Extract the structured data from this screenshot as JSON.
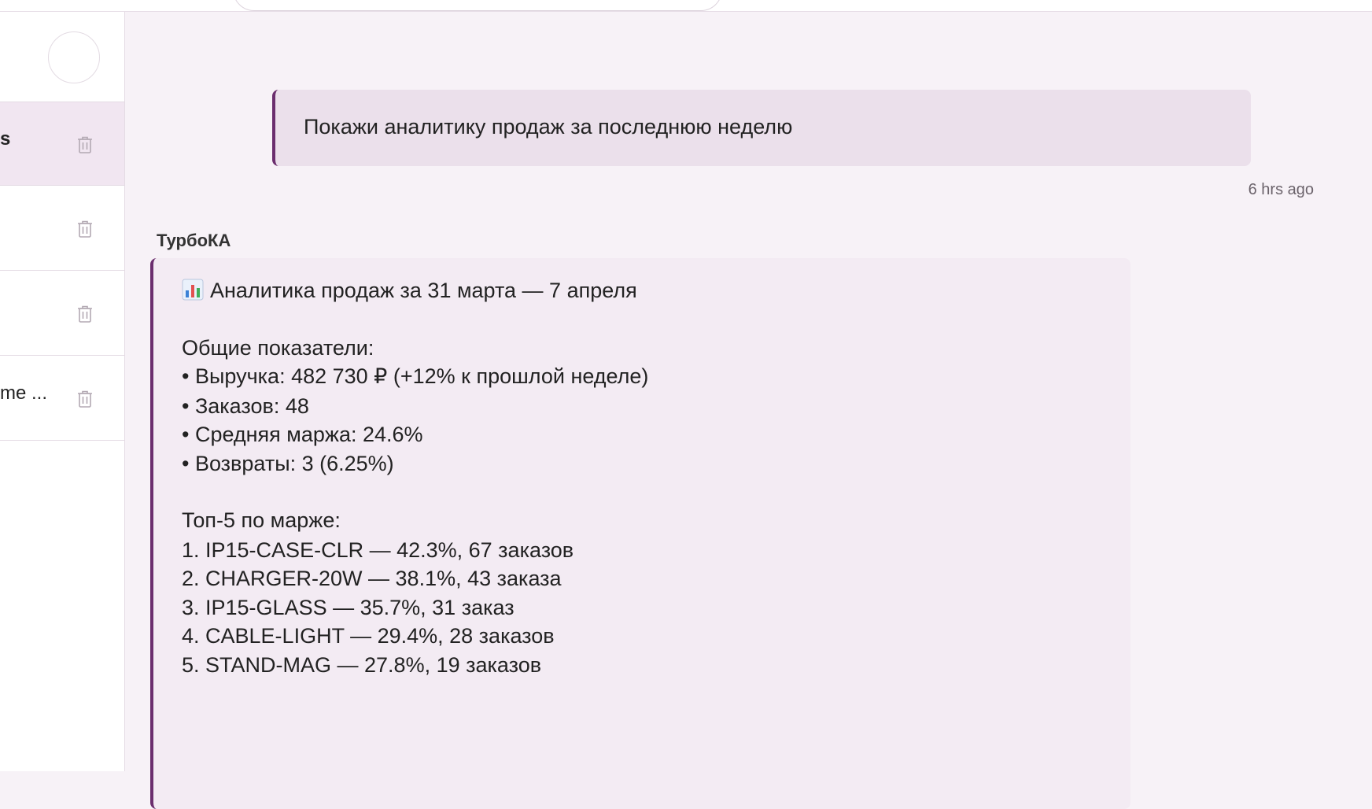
{
  "sidebar": {
    "items": [
      {
        "label": "s",
        "active": true
      },
      {
        "label": "",
        "active": false
      },
      {
        "label": "",
        "active": false
      },
      {
        "label": "me ...",
        "active": false
      }
    ]
  },
  "chat": {
    "user_message": "Покажи аналитику продаж за последнюю неделю",
    "user_timestamp": "6 hrs ago",
    "bot_name": "ТурбоКА",
    "bot_lines": [
      "Аналитика продаж за 31 марта — 7 апреля",
      "Общие показатели:",
      "• Выручка: 482 730 ₽ (+12% к прошлой неделе)",
      "• Заказов: 48",
      "• Средняя маржа: 24.6%",
      "• Возвраты: 3 (6.25%)",
      "Топ-5 по марже:",
      "1. IP15-CASE-CLR — 42.3%, 67 заказов",
      "2. CHARGER-20W — 38.1%, 43 заказа",
      "3. IP15-GLASS — 35.7%, 31 заказ",
      "4. CABLE-LIGHT — 29.4%, 28 заказов",
      "5. STAND-MAG — 27.8%, 19 заказов"
    ]
  },
  "icons": {
    "trash": "trash-icon",
    "chart": "bar-chart-icon"
  },
  "colors": {
    "accent": "#6b2e6e",
    "user_bubble": "#ebe0eb",
    "bot_bubble": "#f3ebf3",
    "active_item": "#f1e6f1"
  }
}
